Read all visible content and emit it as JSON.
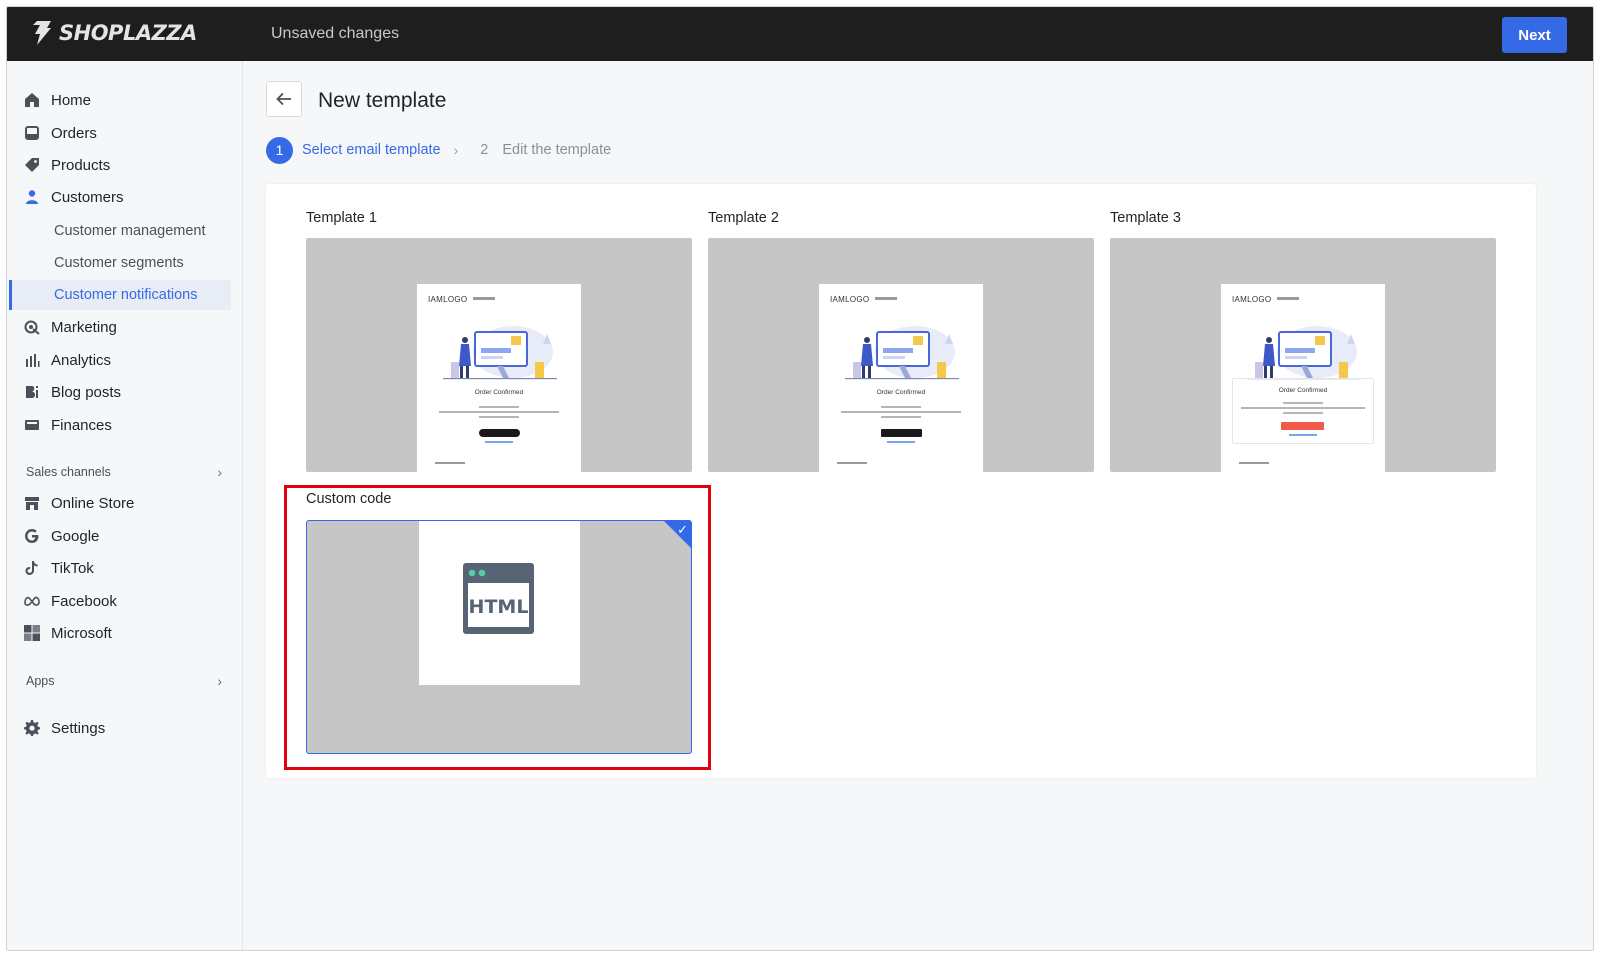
{
  "topbar": {
    "logo_text": "SHOPLAZZA",
    "status": "Unsaved changes",
    "next_label": "Next"
  },
  "sidebar": {
    "items": [
      {
        "label": "Home",
        "icon": "home-icon"
      },
      {
        "label": "Orders",
        "icon": "orders-icon"
      },
      {
        "label": "Products",
        "icon": "tag-icon"
      },
      {
        "label": "Customers",
        "icon": "person-icon"
      }
    ],
    "customer_sub": [
      {
        "label": "Customer management"
      },
      {
        "label": "Customer segments"
      },
      {
        "label": "Customer notifications",
        "active": true
      }
    ],
    "items2": [
      {
        "label": "Marketing",
        "icon": "marketing-icon"
      },
      {
        "label": "Analytics",
        "icon": "analytics-icon"
      },
      {
        "label": "Blog posts",
        "icon": "blog-icon"
      },
      {
        "label": "Finances",
        "icon": "finances-icon"
      }
    ],
    "sales_channels_label": "Sales channels",
    "channels": [
      {
        "label": "Online Store",
        "icon": "store-icon"
      },
      {
        "label": "Google",
        "icon": "google-icon"
      },
      {
        "label": "TikTok",
        "icon": "tiktok-icon"
      },
      {
        "label": "Facebook",
        "icon": "meta-icon"
      },
      {
        "label": "Microsoft",
        "icon": "microsoft-icon"
      }
    ],
    "apps_label": "Apps",
    "settings_label": "Settings"
  },
  "page": {
    "title": "New template",
    "steps": [
      {
        "num": "1",
        "label": "Select email template",
        "active": true
      },
      {
        "num": "2",
        "label": "Edit the template",
        "active": false
      }
    ]
  },
  "templates": [
    {
      "label": "Template 1",
      "brand": "IAMLOGO",
      "heading": "Order Confirmed"
    },
    {
      "label": "Template 2",
      "brand": "IAMLOGO",
      "heading": "Order Confirmed"
    },
    {
      "label": "Template 3",
      "brand": "IAMLOGO",
      "heading": "Order Confirmed"
    }
  ],
  "custom": {
    "label": "Custom code",
    "icon_text": "HTML",
    "selected": true
  },
  "colors": {
    "accent": "#356ae6",
    "highlight": "#e0000f",
    "topbar": "#1e1e1e"
  }
}
